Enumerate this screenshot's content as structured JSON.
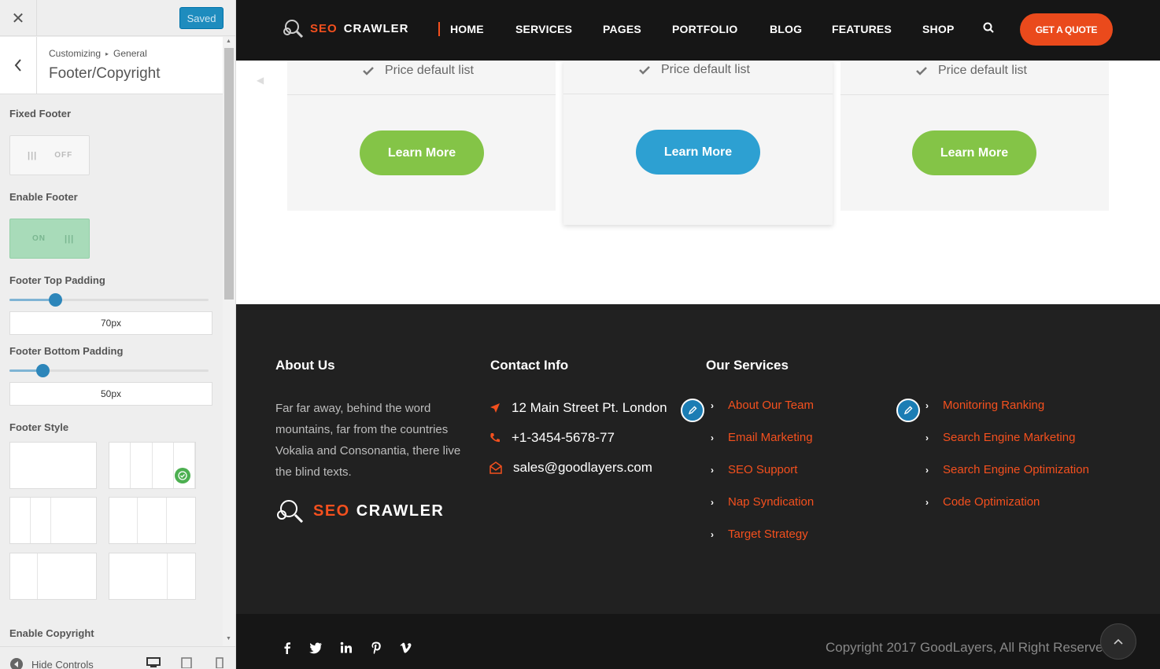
{
  "customizer": {
    "close_glyph": "✕",
    "saved_label": "Saved",
    "breadcrumb": {
      "root": "Customizing",
      "separator": "▸",
      "parent": "General"
    },
    "section_title": "Footer/Copyright",
    "fixed_footer": {
      "label": "Fixed Footer",
      "state": "OFF",
      "grip": "|||"
    },
    "enable_footer": {
      "label": "Enable Footer",
      "state": "ON",
      "grip": "|||"
    },
    "footer_top_padding": {
      "label": "Footer Top Padding",
      "value": "70px",
      "slider_fraction": 0.23
    },
    "footer_bottom_padding": {
      "label": "Footer Bottom Padding",
      "value": "50px",
      "slider_fraction": 0.165
    },
    "footer_style": {
      "label": "Footer Style",
      "selected_option": 2
    },
    "enable_copyright": {
      "label": "Enable Copyright"
    },
    "hide_controls_label": "Hide Controls",
    "scroll_up_glyph": "▲",
    "scroll_down_glyph": "▼"
  },
  "site": {
    "logo": {
      "seo": "SEO",
      "crawler": "CRAWLER"
    },
    "nav": [
      "HOME",
      "SERVICES",
      "PAGES",
      "PORTFOLIO",
      "BLOG",
      "FEATURES",
      "SHOP"
    ],
    "quote_button": "GET A QUOTE",
    "pricing": {
      "item_text": "Price default list",
      "button_label": "Learn More",
      "button_colors": [
        "#84c447",
        "#2da0d2",
        "#84c447"
      ]
    },
    "footer": {
      "about": {
        "heading": "About Us",
        "text": "Far far away, behind the word mountains, far from the countries Vokalia and Consonantia, there live the blind texts."
      },
      "contact": {
        "heading": "Contact Info",
        "address": "12 Main Street Pt. London",
        "phone": "+1-3454-5678-77",
        "email": "sales@goodlayers.com"
      },
      "services": {
        "heading": "Our Services",
        "column1": [
          "About Our Team",
          "Email Marketing",
          "SEO Support",
          "Nap Syndication",
          "Target Strategy"
        ],
        "column2": [
          "Monitoring Ranking",
          "Search Engine Marketing",
          "Search Engine Optimization",
          "Code Optimization"
        ]
      }
    },
    "copyright": "Copyright 2017 GoodLayers, All Right Reserved",
    "social": [
      "facebook-icon",
      "twitter-icon",
      "linkedin-icon",
      "pinterest-icon",
      "vimeo-icon"
    ],
    "colors": {
      "accent": "#f4501e",
      "nav_bg": "#161616",
      "footer_bg": "#212121",
      "wp_blue": "#1e8cbe"
    }
  }
}
